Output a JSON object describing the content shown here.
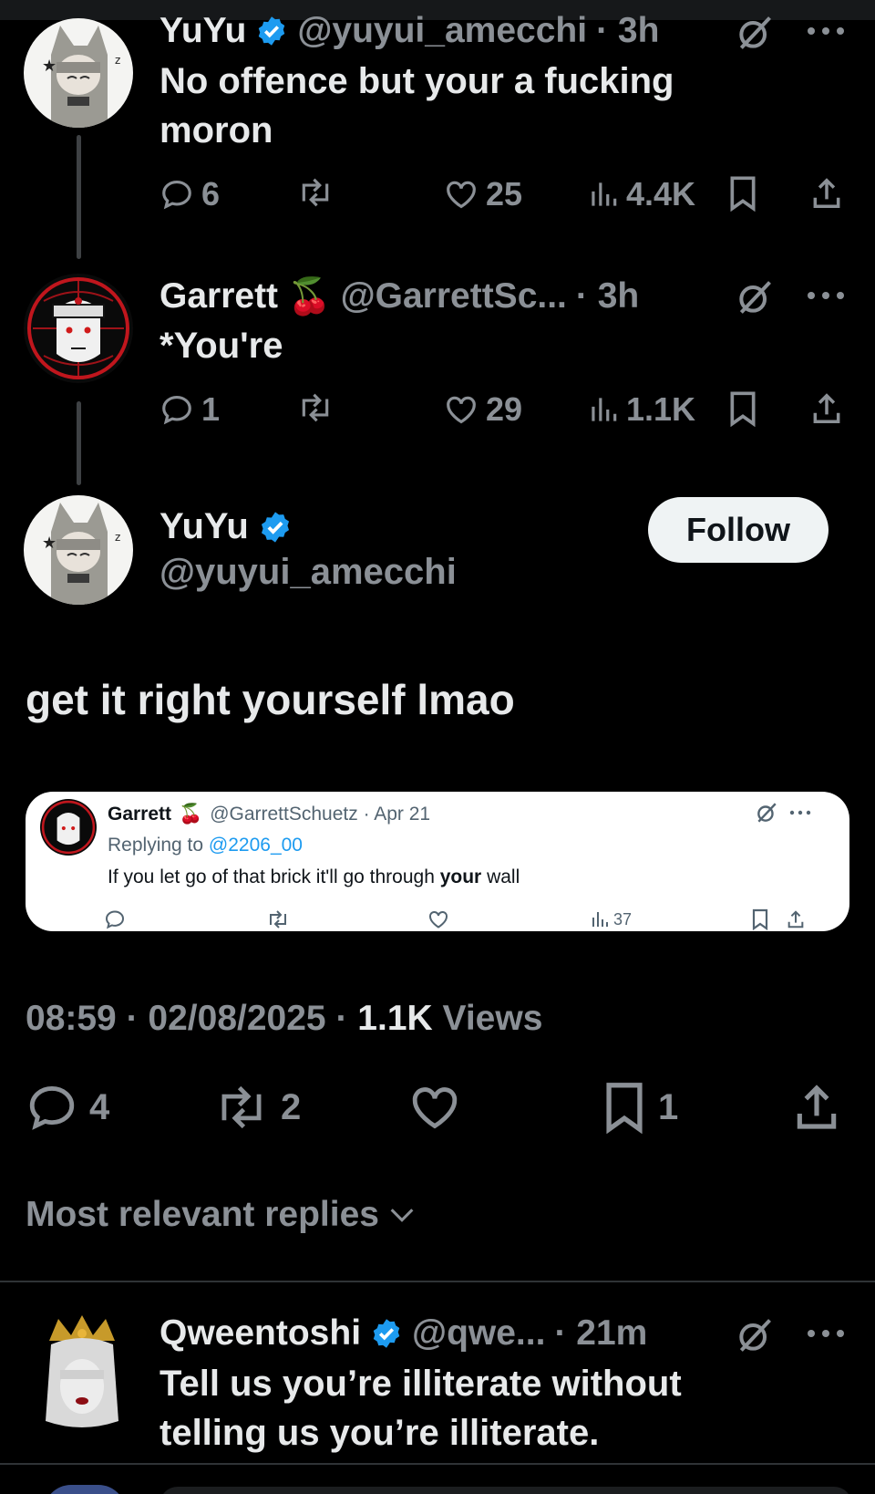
{
  "tweets": [
    {
      "name": "YuYu",
      "handle": "@yuyui_amecchi",
      "time": "· 3h",
      "text": "No offence but your a fucking moron",
      "replies": "6",
      "retweets": "",
      "likes": "25",
      "views": "4.4K"
    },
    {
      "name": "Garrett",
      "emoji": "🍒",
      "handle": "@GarrettSc...",
      "time": "· 3h",
      "text": "*You're",
      "replies": "1",
      "retweets": "",
      "likes": "29",
      "views": "1.1K"
    }
  ],
  "main": {
    "name": "YuYu",
    "handle": "@yuyui_amecchi",
    "follow_label": "Follow",
    "text": "get it right yourself lmao",
    "time": "08:59",
    "date": "02/08/2025",
    "views_count": "1.1K",
    "views_label": "Views",
    "replies": "4",
    "retweets": "2",
    "likes": "",
    "bookmarks": "1"
  },
  "quote": {
    "name": "Garrett",
    "emoji": "🍒",
    "handle": "@GarrettSchuetz · Apr 21",
    "reply_prefix": "Replying to",
    "reply_to": "@2206_00",
    "text_before": "If you let go of that brick it'll go through ",
    "text_bold": "your",
    "text_after": " wall",
    "views": "37"
  },
  "sort_label": "Most relevant replies",
  "reply": {
    "name": "Qweentoshi",
    "handle": "@qwe...",
    "time": "· 21m",
    "text": "Tell us you’re illiterate without telling us you’re illiterate."
  },
  "colors": {
    "background": "#000000",
    "text_primary": "#e7e9ea",
    "text_secondary": "#8b9096",
    "verified_blue": "#1d9bf0",
    "divider": "#2f3336"
  },
  "icons": [
    "reply-icon",
    "retweet-icon",
    "like-icon",
    "views-icon",
    "bookmark-icon",
    "share-icon",
    "grok-icon",
    "more-icon",
    "verified-icon",
    "chevron-down-icon"
  ]
}
